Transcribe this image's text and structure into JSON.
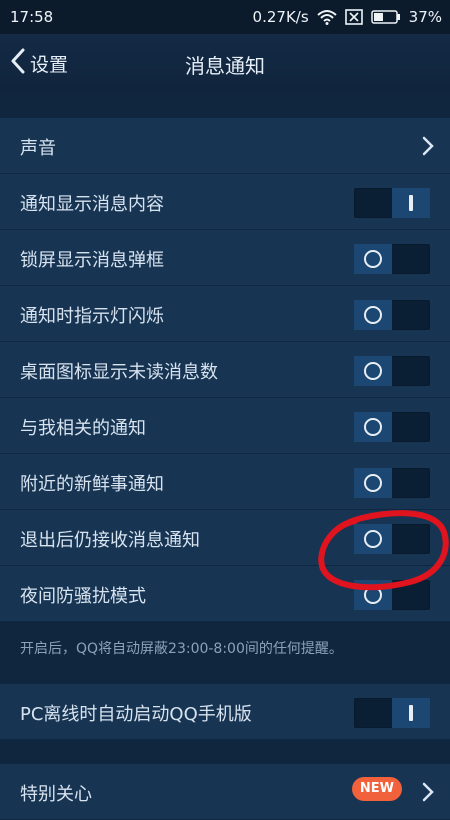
{
  "status_bar": {
    "time": "17:58",
    "net_speed": "0.27K/s",
    "battery": "37%"
  },
  "header": {
    "back_label": "设置",
    "title": "消息通知"
  },
  "sections": {
    "sound": {
      "label": "声音"
    },
    "settings": [
      {
        "label": "通知显示消息内容",
        "state": "on"
      },
      {
        "label": "锁屏显示消息弹框",
        "state": "off"
      },
      {
        "label": "通知时指示灯闪烁",
        "state": "off"
      },
      {
        "label": "桌面图标显示未读消息数",
        "state": "off"
      },
      {
        "label": "与我相关的通知",
        "state": "off"
      },
      {
        "label": "附近的新鲜事通知",
        "state": "off"
      },
      {
        "label": "退出后仍接收消息通知",
        "state": "off"
      },
      {
        "label": "夜间防骚扰模式",
        "state": "off"
      }
    ],
    "night_hint": "开启后，QQ将自动屏蔽23:00-8:00间的任何提醒。",
    "pc_offline": {
      "label": "PC离线时自动启动QQ手机版",
      "state": "on"
    },
    "special_care": {
      "label": "特别关心",
      "badge": "NEW"
    }
  },
  "colors": {
    "background": "#10263f",
    "row": "#173453",
    "annotation": "#e0141e",
    "badge": "#f0613c"
  }
}
